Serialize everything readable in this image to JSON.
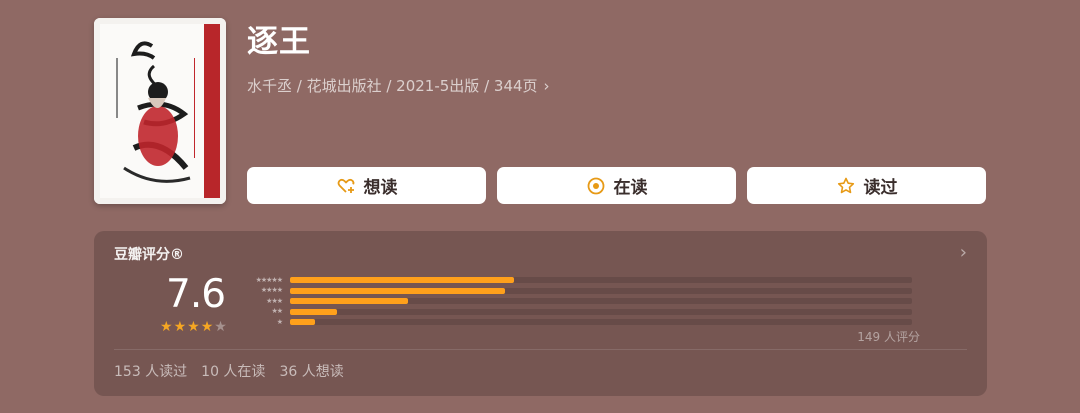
{
  "book": {
    "title": "逐王",
    "meta": "水千丞 / 花城出版社 / 2021-5出版 / 344页",
    "meta_chevron": "›"
  },
  "actions": [
    {
      "label": "想读",
      "icon": "heart-plus-icon"
    },
    {
      "label": "在读",
      "icon": "target-circle-icon"
    },
    {
      "label": "读过",
      "icon": "star-outline-icon"
    }
  ],
  "rating": {
    "title": "豆瓣评分®",
    "chevron": "›",
    "score": "7.6",
    "stars_filled": 4,
    "stars_total": 5,
    "distribution": [
      {
        "stars": 5,
        "label": "★★★★★",
        "fraction": 0.36
      },
      {
        "stars": 4,
        "label": "★★★★",
        "fraction": 0.345
      },
      {
        "stars": 3,
        "label": "★★★",
        "fraction": 0.19
      },
      {
        "stars": 2,
        "label": "★★",
        "fraction": 0.075
      },
      {
        "stars": 1,
        "label": "★",
        "fraction": 0.04
      }
    ],
    "count_label": "149 人评分"
  },
  "stats": {
    "read": "153 人读过",
    "reading": "10 人在读",
    "want": "36 人想读"
  },
  "colors": {
    "background": "#8f6964",
    "panel": "#765652",
    "accent": "#ffa01b",
    "button_icon": "#e79a16"
  }
}
